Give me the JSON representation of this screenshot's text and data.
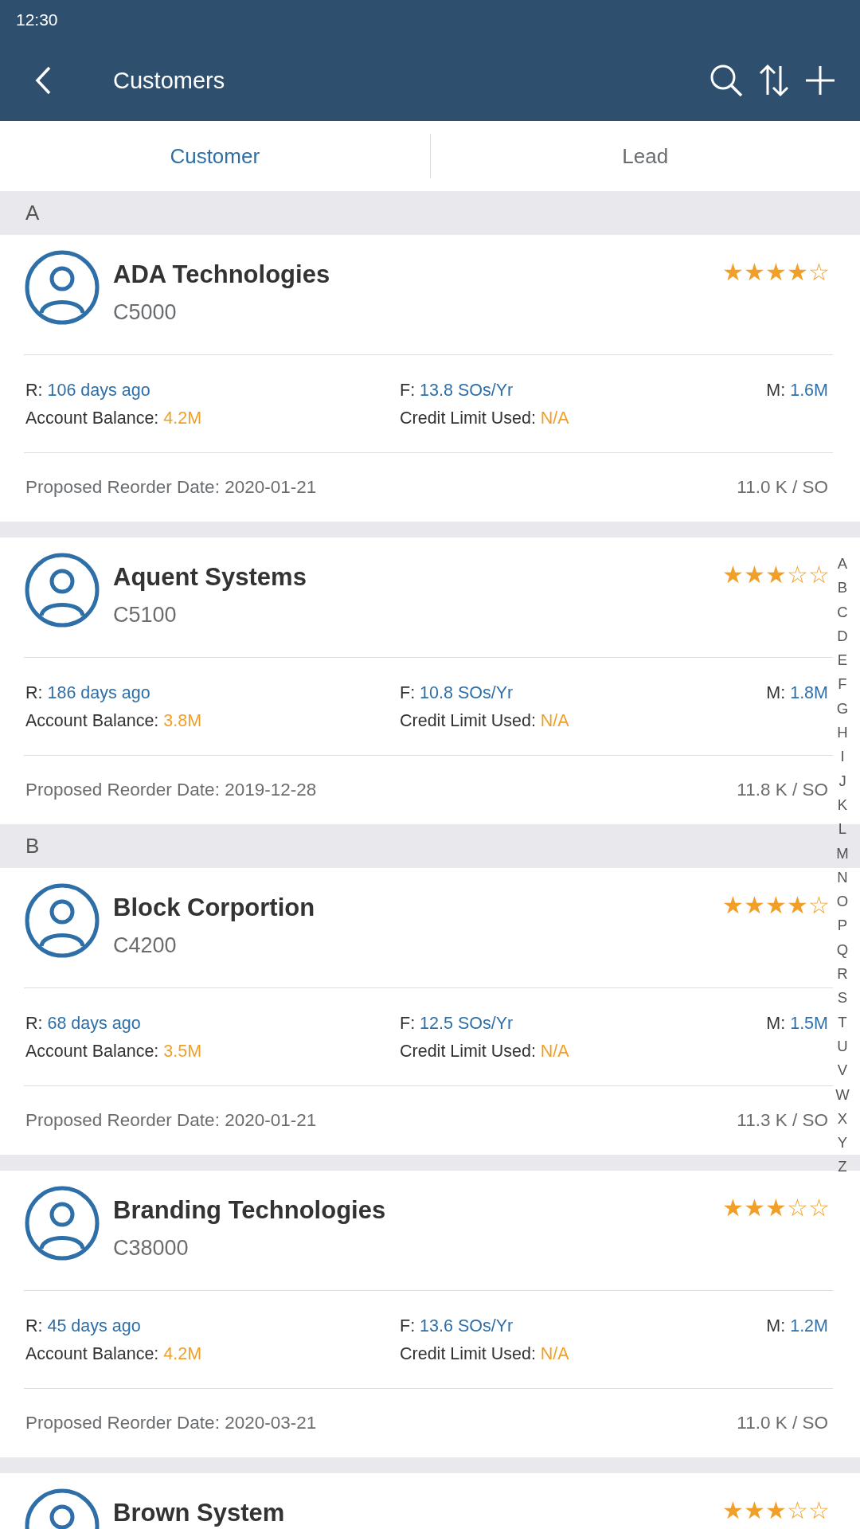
{
  "status_bar": {
    "time": "12:30"
  },
  "header": {
    "title": "Customers"
  },
  "tabs": [
    {
      "label": "Customer",
      "selected": true
    },
    {
      "label": "Lead",
      "selected": false
    }
  ],
  "sections": [
    {
      "letter": "A",
      "customers": [
        {
          "name": "ADA Technologies",
          "id": "C5000",
          "stars": 4,
          "r_label": "R:",
          "r_value": "106 days ago",
          "f_label": "F:",
          "f_value": "13.8 SOs/Yr",
          "m_label": "M:",
          "m_value": "1.6M",
          "balance_label": "Account Balance:",
          "balance_value": "4.2M",
          "credit_label": "Credit Limit Used:",
          "credit_value": "N/A",
          "reorder": "Proposed Reorder Date: 2020-01-21",
          "per_so": "11.0 K / SO"
        },
        {
          "name": "Aquent Systems",
          "id": "C5100",
          "stars": 3,
          "r_label": "R:",
          "r_value": "186 days ago",
          "f_label": "F:",
          "f_value": "10.8 SOs/Yr",
          "m_label": "M:",
          "m_value": "1.8M",
          "balance_label": "Account Balance:",
          "balance_value": "3.8M",
          "credit_label": "Credit Limit Used:",
          "credit_value": "N/A",
          "reorder": "Proposed Reorder Date: 2019-12-28",
          "per_so": "11.8 K / SO"
        }
      ]
    },
    {
      "letter": "B",
      "customers": [
        {
          "name": "Block Corportion",
          "id": "C4200",
          "stars": 4,
          "r_label": "R:",
          "r_value": "68 days ago",
          "f_label": "F:",
          "f_value": "12.5 SOs/Yr",
          "m_label": "M:",
          "m_value": "1.5M",
          "balance_label": "Account Balance:",
          "balance_value": "3.5M",
          "credit_label": "Credit Limit Used:",
          "credit_value": "N/A",
          "reorder": "Proposed Reorder Date: 2020-01-21",
          "per_so": "11.3 K / SO"
        },
        {
          "name": "Branding Technologies",
          "id": "C38000",
          "stars": 3,
          "r_label": "R:",
          "r_value": "45 days ago",
          "f_label": "F:",
          "f_value": "13.6 SOs/Yr",
          "m_label": "M:",
          "m_value": "1.2M",
          "balance_label": "Account Balance:",
          "balance_value": "4.2M",
          "credit_label": "Credit Limit Used:",
          "credit_value": "N/A",
          "reorder": "Proposed Reorder Date: 2020-03-21",
          "per_so": "11.0 K / SO"
        },
        {
          "name": "Brown System",
          "stars": 3
        }
      ]
    }
  ],
  "index": [
    "A",
    "B",
    "C",
    "D",
    "E",
    "F",
    "G",
    "H",
    "I",
    "J",
    "K",
    "L",
    "M",
    "N",
    "O",
    "P",
    "Q",
    "R",
    "S",
    "T",
    "U",
    "V",
    "W",
    "X",
    "Y",
    "Z"
  ]
}
